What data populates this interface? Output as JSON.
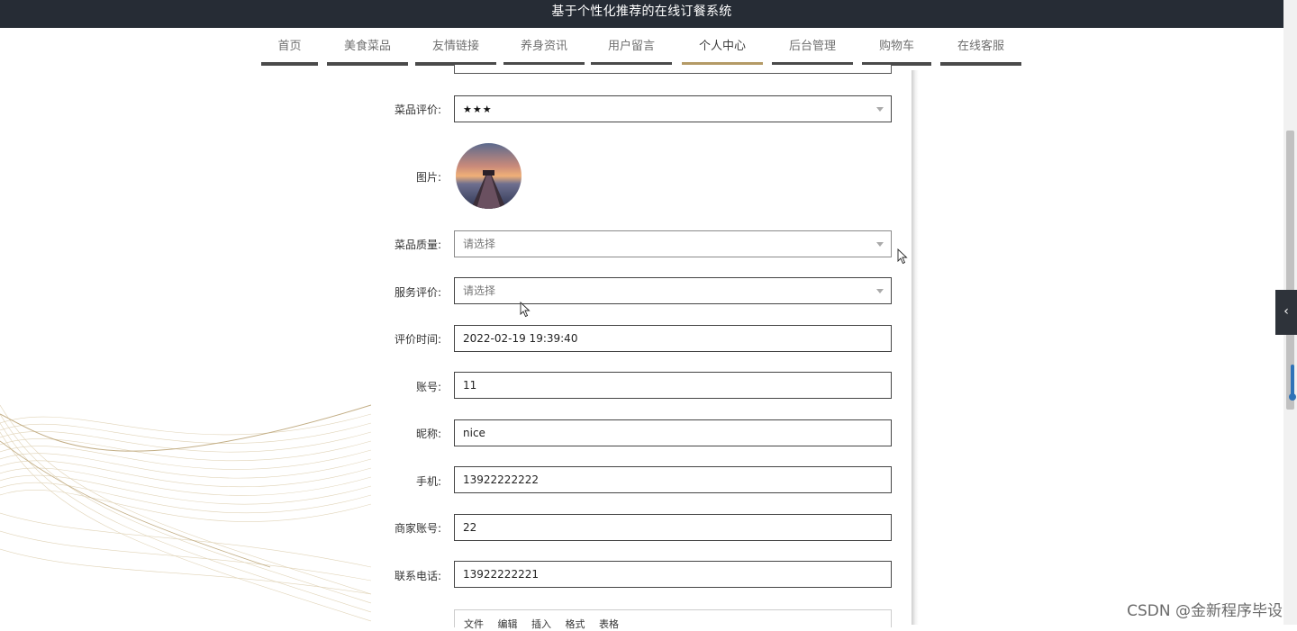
{
  "app": {
    "title": "基于个性化推荐的在线订餐系统"
  },
  "nav": {
    "items": [
      {
        "label": "首页"
      },
      {
        "label": "美食菜品"
      },
      {
        "label": "友情链接"
      },
      {
        "label": "养身资讯"
      },
      {
        "label": "用户留言"
      },
      {
        "label": "个人中心",
        "active": true
      },
      {
        "label": "后台管理"
      },
      {
        "label": "购物车"
      },
      {
        "label": "在线客服"
      }
    ]
  },
  "form": {
    "dish_rating": {
      "label": "菜品评价:",
      "value": "★★★"
    },
    "picture": {
      "label": "图片:"
    },
    "dish_quality": {
      "label": "菜品质量:",
      "placeholder": "请选择"
    },
    "service_rating": {
      "label": "服务评价:",
      "placeholder": "请选择"
    },
    "rating_time": {
      "label": "评价时间:",
      "value": "2022-02-19 19:39:40"
    },
    "account": {
      "label": "账号:",
      "value": "11"
    },
    "nickname": {
      "label": "昵称:",
      "value": "nice"
    },
    "phone": {
      "label": "手机:",
      "value": "13922222222"
    },
    "merchant_account": {
      "label": "商家账号:",
      "value": "22"
    },
    "contact_phone": {
      "label": "联系电话:",
      "value": "13922222221"
    }
  },
  "editor": {
    "menu": [
      "文件",
      "编辑",
      "插入",
      "格式",
      "表格"
    ]
  },
  "watermark": "CSDN @金新程序毕设",
  "colors": {
    "topbar": "#262c35",
    "nav_active": "#b49a66",
    "nav_underline": "#4a4a4a"
  }
}
